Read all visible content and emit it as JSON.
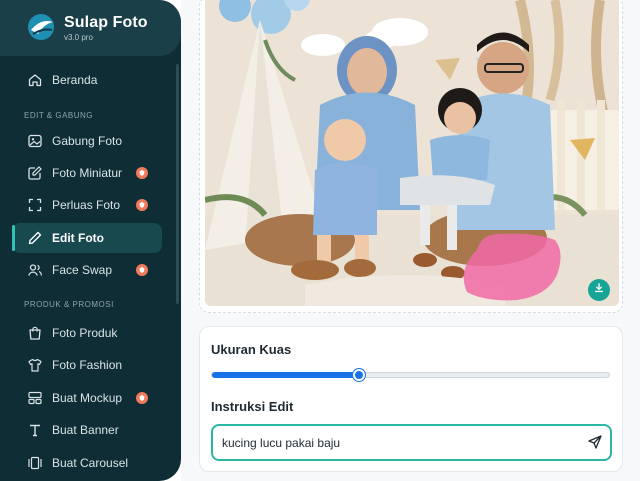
{
  "brand": {
    "title": "Sulap Foto",
    "version": "v3.0 pro"
  },
  "nav": {
    "home": {
      "label": "Beranda",
      "icon": "home-icon"
    },
    "sections": [
      {
        "title": "EDIT & GABUNG",
        "items": [
          {
            "label": "Gabung Foto",
            "icon": "image-icon",
            "badge": false
          },
          {
            "label": "Foto Miniatur",
            "icon": "edit-square-icon",
            "badge": true
          },
          {
            "label": "Perluas Foto",
            "icon": "expand-icon",
            "badge": true
          },
          {
            "label": "Edit Foto",
            "icon": "pencil-icon",
            "badge": false,
            "active": true
          },
          {
            "label": "Face Swap",
            "icon": "users-icon",
            "badge": true
          }
        ]
      },
      {
        "title": "PRODUK & PROMOSI",
        "items": [
          {
            "label": "Foto Produk",
            "icon": "shopping-bag-icon",
            "badge": false
          },
          {
            "label": "Foto Fashion",
            "icon": "shirt-icon",
            "badge": false
          },
          {
            "label": "Buat Mockup",
            "icon": "layout-icon",
            "badge": true
          },
          {
            "label": "Buat Banner",
            "icon": "text-icon",
            "badge": false
          },
          {
            "label": "Buat Carousel",
            "icon": "carousel-icon",
            "badge": false
          }
        ]
      }
    ]
  },
  "editor": {
    "brush_size_label": "Ukuran Kuas",
    "brush_size_value": 0.37,
    "instruction_label": "Instruksi Edit",
    "instruction_value": "kucing lucu pakai baju"
  },
  "colors": {
    "sidebar_bg": "#0f2d35",
    "accent": "#2bb7a4",
    "slider": "#1973e8",
    "badge": "#f07a5a",
    "mask": "#f06aa6"
  }
}
